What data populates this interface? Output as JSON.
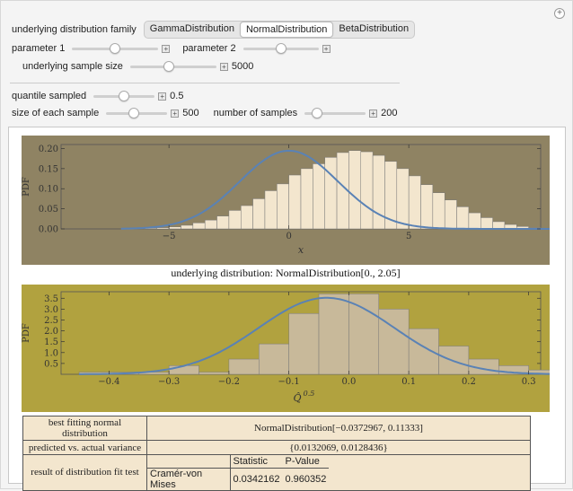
{
  "controls": {
    "family_label": "underlying distribution family",
    "families": [
      "GammaDistribution",
      "NormalDistribution",
      "BetaDistribution"
    ],
    "selected_family": "NormalDistribution",
    "param1_label": "parameter 1",
    "param2_label": "parameter 2",
    "sample_size_label": "underlying sample size",
    "sample_size_value": "5000",
    "quantile_label": "quantile sampled",
    "quantile_value": "0.5",
    "each_sample_label": "size of each sample",
    "each_sample_value": "500",
    "num_samples_label": "number of samples",
    "num_samples_value": "200"
  },
  "sliders": {
    "param1": 0.5,
    "param2": 0.5,
    "sample_size": 0.45,
    "quantile": 0.5,
    "each_sample": 0.45,
    "num_samples": 0.2
  },
  "plot1": {
    "ylabel": "PDF",
    "xlabel": "x",
    "caption": "underlying distribution: NormalDistribution[0., 2.05]",
    "bg": "#8f8363",
    "bar_fill": "#f3e6ce",
    "curve_color": "#5a82b5"
  },
  "plot2": {
    "ylabel": "PDF",
    "xlabel": "Q̂",
    "xlabel_sup": "0.5",
    "bg": "#b1a23f",
    "bar_fill": "#c8b99a",
    "curve_color": "#5a82b5"
  },
  "chart_data": [
    {
      "type": "bar",
      "ylabel": "PDF",
      "xlabel": "x",
      "xlim": [
        -9.5,
        10.5
      ],
      "ylim": [
        0,
        0.21
      ],
      "xticks": [
        -5,
        0,
        5
      ],
      "yticks": [
        "0.00",
        "0.05",
        "0.10",
        "0.15",
        "0.20"
      ],
      "bin_width": 0.5,
      "bins_start": -7,
      "values": [
        0.001,
        0.001,
        0.002,
        0.003,
        0.005,
        0.009,
        0.015,
        0.022,
        0.032,
        0.046,
        0.058,
        0.075,
        0.095,
        0.112,
        0.134,
        0.15,
        0.162,
        0.178,
        0.19,
        0.195,
        0.192,
        0.183,
        0.168,
        0.15,
        0.132,
        0.11,
        0.09,
        0.072,
        0.055,
        0.04,
        0.028,
        0.018,
        0.011,
        0.006,
        0.003,
        0.001
      ],
      "curve": {
        "type": "normal",
        "mean": 0,
        "sd": 2.05
      }
    },
    {
      "type": "bar",
      "ylabel": "PDF",
      "xlim": [
        -0.48,
        0.32
      ],
      "ylim": [
        0,
        3.8
      ],
      "xticks": [
        "-0.4",
        "-0.3",
        "-0.2",
        "-0.1",
        "0.0",
        "0.1",
        "0.2",
        "0.3"
      ],
      "yticks": [
        "0.5",
        "1.0",
        "1.5",
        "2.0",
        "2.5",
        "3.0",
        "3.5"
      ],
      "bin_width": 0.05,
      "bins_start": -0.45,
      "values": [
        0.1,
        0.1,
        0.1,
        0.4,
        0.1,
        0.7,
        1.4,
        2.8,
        3.7,
        3.7,
        3.0,
        2.1,
        1.3,
        0.7,
        0.4,
        0.2
      ],
      "curve": {
        "type": "normal",
        "mean": -0.0372967,
        "sd": 0.11333
      }
    }
  ],
  "results": {
    "row1_label": "best fitting normal distribution",
    "row1_value": "NormalDistribution[−0.0372967, 0.11333]",
    "row2_label": "predicted vs. actual variance",
    "row2_value": "{0.0132069, 0.0128436}",
    "row3_label": "result of distribution fit test",
    "col_statistic": "Statistic",
    "col_pvalue": "P-Value",
    "test_name": "Cramér-von Mises",
    "statistic": "0.0342162",
    "pvalue": "0.960352"
  }
}
